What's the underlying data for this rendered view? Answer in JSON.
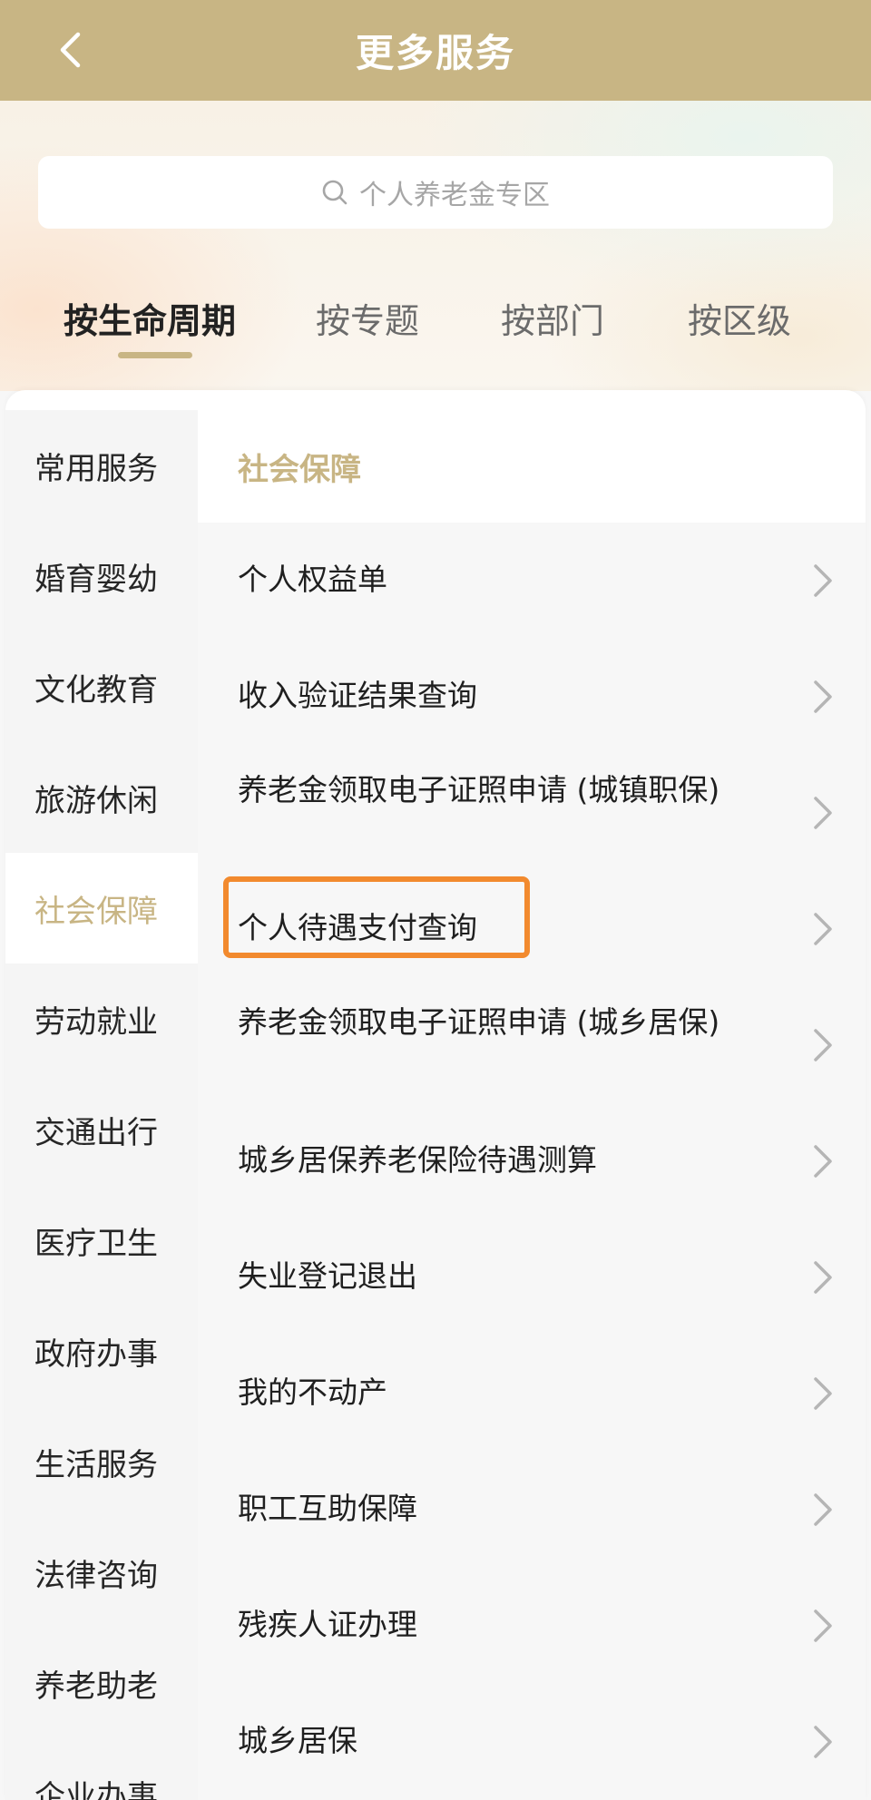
{
  "header": {
    "title": "更多服务"
  },
  "search": {
    "placeholder": "个人养老金专区"
  },
  "tabs": [
    {
      "label": "按生命周期"
    },
    {
      "label": "按专题"
    },
    {
      "label": "按部门"
    },
    {
      "label": "按区级"
    }
  ],
  "sidebar": {
    "items": [
      {
        "label": "常用服务"
      },
      {
        "label": "婚育婴幼"
      },
      {
        "label": "文化教育"
      },
      {
        "label": "旅游休闲"
      },
      {
        "label": "社会保障"
      },
      {
        "label": "劳动就业"
      },
      {
        "label": "交通出行"
      },
      {
        "label": "医疗卫生"
      },
      {
        "label": "政府办事"
      },
      {
        "label": "生活服务"
      },
      {
        "label": "法律咨询"
      },
      {
        "label": "养老助老"
      },
      {
        "label": "企业办事"
      }
    ]
  },
  "section": {
    "title": "社会保障"
  },
  "services": [
    {
      "label": "个人权益单"
    },
    {
      "label": "收入验证结果查询"
    },
    {
      "label": "养老金领取电子证照申请 (城镇职保)"
    },
    {
      "label": "个人待遇支付查询"
    },
    {
      "label": "养老金领取电子证照申请 (城乡居保)"
    },
    {
      "label": "城乡居保养老保险待遇测算"
    },
    {
      "label": "失业登记退出"
    },
    {
      "label": "我的不动产"
    },
    {
      "label": "职工互助保障"
    },
    {
      "label": "残疾人证办理"
    },
    {
      "label": "城乡居保"
    }
  ],
  "colors": {
    "accent": "#c8b584",
    "highlight": "#f28a2e"
  }
}
